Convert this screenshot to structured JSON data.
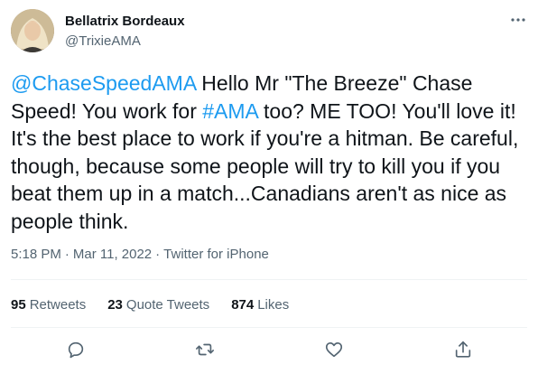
{
  "author": {
    "display_name": "Bellatrix Bordeaux",
    "handle": "@TrixieAMA"
  },
  "tweet": {
    "mention": "@ChaseSpeedAMA",
    "text_1": " Hello Mr \"The Breeze\" Chase Speed! You work for ",
    "hashtag": "#AMA",
    "text_2": " too? ME TOO! You'll love it! It's the best place to work if you're a hitman. Be careful, though, because some people will try to kill you if you beat them up in a match...Canadians aren't as nice as people think."
  },
  "meta": {
    "time": "5:18 PM",
    "sep1": "·",
    "date": "Mar 11, 2022",
    "sep2": "·",
    "source": "Twitter for iPhone"
  },
  "stats": {
    "retweets_count": "95",
    "retweets_label": "Retweets",
    "quotes_count": "23",
    "quotes_label": "Quote Tweets",
    "likes_count": "874",
    "likes_label": "Likes"
  },
  "actions": {
    "reply_icon": "reply-icon",
    "retweet_icon": "retweet-icon",
    "like_icon": "heart-icon",
    "share_icon": "share-icon"
  },
  "colors": {
    "accent": "#1d9bf0",
    "text": "#0f1419",
    "muted": "#536471",
    "divider": "#eff3f4"
  }
}
